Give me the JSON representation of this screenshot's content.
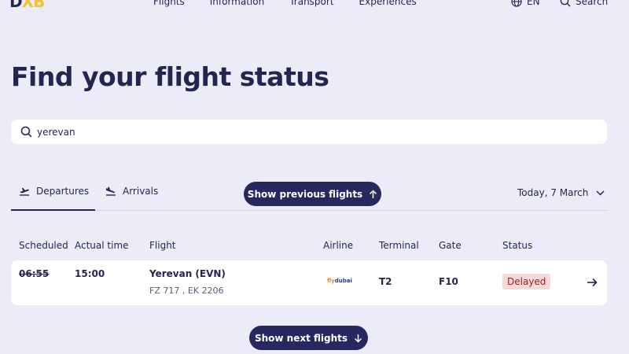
{
  "header": {
    "logo_main": "D",
    "logo_accent": "XB",
    "nav": [
      "Flights",
      "Information",
      "Transport",
      "Experiences"
    ],
    "language": "EN",
    "search_label": "Search"
  },
  "page_title": "Find your flight status",
  "search": {
    "value": "yerevan",
    "placeholder": ""
  },
  "tabs": {
    "departures": "Departures",
    "arrivals": "Arrivals",
    "active": "departures"
  },
  "buttons": {
    "previous": "Show previous flights",
    "next": "Show next flights"
  },
  "date_selector": "Today, 7 March",
  "table": {
    "headers": [
      "Scheduled",
      "Actual time",
      "Flight",
      "Airline",
      "Terminal",
      "Gate",
      "Status"
    ],
    "rows": [
      {
        "scheduled": "06:55",
        "actual": "15:00",
        "destination": "Yerevan (EVN)",
        "flight_codes": "FZ 717 , EK 2206",
        "airline_logo_a": "fly",
        "airline_logo_b": "dubai",
        "terminal": "T2",
        "gate": "F10",
        "status": "Delayed"
      }
    ]
  },
  "colors": {
    "background": "#ececf8",
    "primary": "#282860",
    "accent": "#f2c230",
    "delayed_bg": "#f6dada",
    "delayed_text": "#9a1b1b"
  }
}
